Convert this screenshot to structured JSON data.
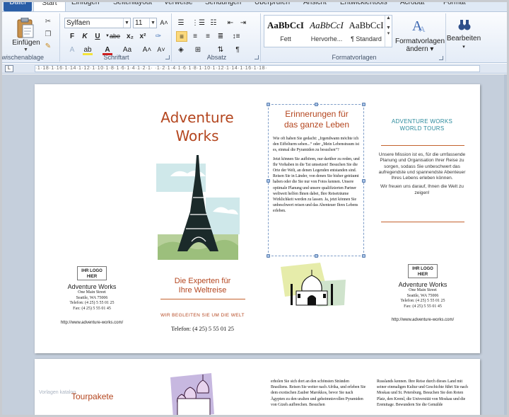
{
  "ribbon": {
    "tabs": [
      "Datei",
      "Start",
      "Einfügen",
      "Seitenlayout",
      "Verweise",
      "Sendungen",
      "Überprüfen",
      "Ansicht",
      "Entwicklertools",
      "Acrobat",
      "Format"
    ],
    "active_tab": "Start",
    "clipboard": {
      "paste_label": "Einfügen",
      "group_label": "Zwischenablage"
    },
    "font": {
      "name": "Sylfaen",
      "size": "11",
      "group_label": "Schriftart"
    },
    "paragraph": {
      "group_label": "Absatz"
    },
    "styles": {
      "items": [
        {
          "sample": "AaBbCcI",
          "name": "Fett"
        },
        {
          "sample": "AaBbCcI",
          "name": "Hervorhe..."
        },
        {
          "sample": "AaBbCcI",
          "name": "¶ Standard"
        }
      ],
      "change_label_1": "Formatvorlagen",
      "change_label_2": "ändern",
      "group_label": "Formatvorlagen"
    },
    "editing": {
      "label": "Bearbeiten"
    }
  },
  "ruler": {
    "corner": "L",
    "marks": "·1·18·1·16·1·14·1·12·1·10·1·8·1·6·1·4·1·2·1·  ·1·2·1·4·1·6·1·8·1·10·1·12·1·14·1·16·1·18·"
  },
  "brochure": {
    "title_line1": "Adventure",
    "title_line2": "Works",
    "experts_line1": "Die Experten für",
    "experts_line2": "Ihre Weltreise",
    "tagline": "WIR BEGLEITEN SIE UM DIE WELT",
    "phone": "Telefon: (4 25) 5 55 01 25",
    "logo_line1": "IHR LOGO",
    "logo_line2": "HIER",
    "company": "Adventure Works",
    "street": "One Main Street",
    "city": "Seattle, WA 75006",
    "tel": "Telefon: (4 25) 5 55 01 25",
    "fax": "Fax: (4 25) 5 55 01 45",
    "url": "http://www.adventure-works.com/",
    "textbox_title_line1": "Erinnerungen für",
    "textbox_title_line2": "das ganze Leben",
    "textbox_p1": "Wie oft haben Sie gedacht: „Irgendwann möchte ich den Eiffelturm sehen...“ oder „Mein Lebenstraum ist es, einmal die Pyramiden zu besuchen“?",
    "textbox_p2": "Jetzt können Sie aufhören, nur darüber zu reden, und Ihr Vorhaben in die Tat umsetzen! Besuchen Sie die Orte der Welt, an denen Legenden entstanden sind. Reisen Sie in Länder, von denen Sie bisher geträumt haben oder die Sie nur von Fotos kennen. Unsere optimale Planung und unsere qualifizierten Partner weltweit helfen Ihnen dabei, Ihre Reiseträume Wirklichkeit werden zu lassen. Ja, jetzt können Sie unbeschwert reisen und das Abenteuer Ihres Lebens erleben.",
    "aw_title_line1": "ADVENTURE WORKS",
    "aw_title_line2": "WORLD TOURS",
    "mission_p1": "Unsere Mission ist es, für die umfassende Planung und Organisation Ihrer Reise zu sorgen, sodass Sie unbeschwert das aufregendste und spannendste Abenteuer Ihres Lebens erleben können.",
    "mission_p2": "Wir freuen uns darauf, Ihnen die Welt zu zeigen!"
  },
  "page2": {
    "title": "Tourpakete",
    "watermark": "Vorlagen katalog",
    "col1": "erholen Sie sich dort an den schönsten Stränden Brasiliens. Reisen Sie weiter nach Afrika, und erleben Sie dem exotischen Zauber Marokkos, bevor Sie nach Ägypten zu den uralten und geheimnisvollen Pyramiden von Gizeh aufbrechen. Besuchen",
    "col2": "Russlands kennen. Ihre Reise durch dieses Land mit seiner einmaligen Kultur und Geschichte führt Sie nach Moskau und St. Petersburg. Besuchen Sie den Roten Platz, den Kreml, die Universität von Moskau und die Eremitage. Bewundern Sie die Gemälde"
  },
  "colors": {
    "accent": "#b4461f",
    "teal": "#2a8a9c",
    "ribbon_blue": "#2a5ea7"
  }
}
